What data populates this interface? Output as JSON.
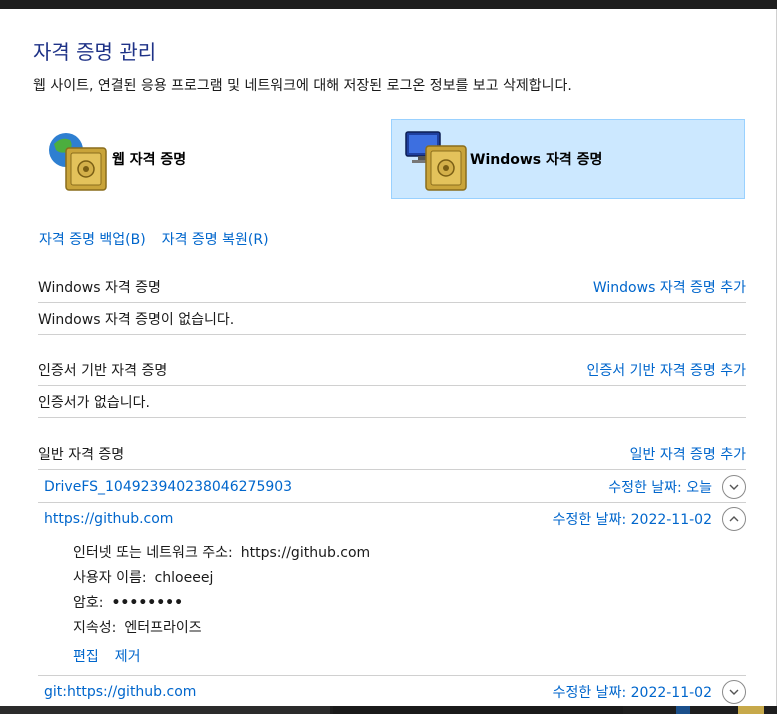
{
  "page": {
    "title": "자격 증명 관리",
    "description": "웹 사이트, 연결된 응용 프로그램 및 네트워크에 대해 저장된 로그온 정보를 보고 삭제합니다."
  },
  "vaults": {
    "web": {
      "label": "웹 자격 증명",
      "icon": "globe-safe-icon"
    },
    "windows": {
      "label": "Windows 자격 증명",
      "icon": "monitor-safe-icon",
      "selected": true
    }
  },
  "backup": {
    "backup_label": "자격 증명 백업(B)",
    "restore_label": "자격 증명 복원(R)"
  },
  "sections": {
    "windows": {
      "title": "Windows 자격 증명",
      "add_label": "Windows 자격 증명 추가",
      "empty_text": "Windows 자격 증명이 없습니다."
    },
    "certificate": {
      "title": "인증서 기반 자격 증명",
      "add_label": "인증서 기반 자격 증명 추가",
      "empty_text": "인증서가 없습니다."
    },
    "generic": {
      "title": "일반 자격 증명",
      "add_label": "일반 자격 증명 추가"
    }
  },
  "credentials": [
    {
      "name": "DriveFS_104923940238046275903",
      "modified_label": "수정한 날짜:",
      "modified": "오늘",
      "expanded": false
    },
    {
      "name": "https://github.com",
      "modified_label": "수정한 날짜:",
      "modified": "2022-11-02",
      "expanded": true,
      "details": {
        "address_label": "인터넷 또는 네트워크 주소:",
        "address": "https://github.com",
        "user_label": "사용자 이름:",
        "user": "chloeeej",
        "password_label": "암호:",
        "password": "••••••••",
        "persistence_label": "지속성:",
        "persistence": "엔터프라이즈"
      },
      "edit_label": "편집",
      "remove_label": "제거"
    },
    {
      "name": "git:https://github.com",
      "modified_label": "수정한 날짜:",
      "modified": "2022-11-02",
      "expanded": false
    }
  ],
  "colors": {
    "link": "#0066cc",
    "title": "#1e3287",
    "selected_tile": "#cce8ff",
    "selected_border": "#99d1ff"
  }
}
